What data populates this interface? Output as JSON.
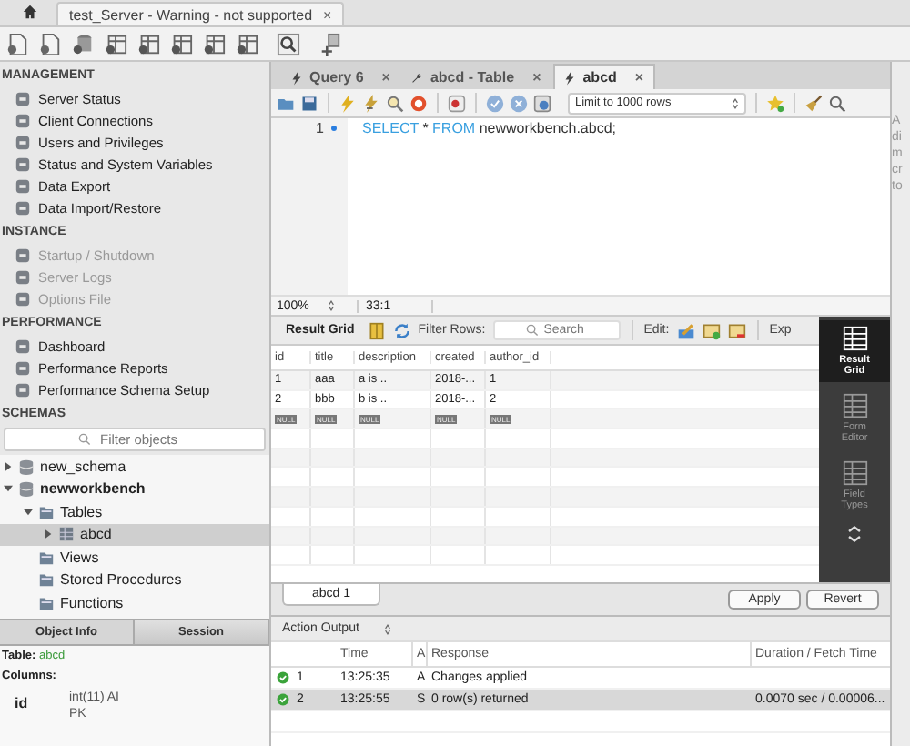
{
  "window_tabs": [
    {
      "label": "test_Server - Warning - not supported",
      "close": "×",
      "selected": true
    }
  ],
  "sidebar": {
    "sections": [
      {
        "title": "MANAGEMENT",
        "items": [
          {
            "label": "Server Status",
            "disabled": false
          },
          {
            "label": "Client Connections",
            "disabled": false
          },
          {
            "label": "Users and Privileges",
            "disabled": false
          },
          {
            "label": "Status and System Variables",
            "disabled": false
          },
          {
            "label": "Data Export",
            "disabled": false
          },
          {
            "label": "Data Import/Restore",
            "disabled": false
          }
        ]
      },
      {
        "title": "INSTANCE",
        "items": [
          {
            "label": "Startup / Shutdown",
            "disabled": true
          },
          {
            "label": "Server Logs",
            "disabled": true
          },
          {
            "label": "Options File",
            "disabled": true
          }
        ]
      },
      {
        "title": "PERFORMANCE",
        "items": [
          {
            "label": "Dashboard",
            "disabled": false
          },
          {
            "label": "Performance Reports",
            "disabled": false
          },
          {
            "label": "Performance Schema Setup",
            "disabled": false
          }
        ]
      }
    ]
  },
  "schemas": {
    "title": "SCHEMAS",
    "filter_placeholder": "Filter objects",
    "tree": [
      {
        "label": "new_schema",
        "kind": "schema",
        "expanded": false,
        "default": false,
        "selected": false
      },
      {
        "label": "newworkbench",
        "kind": "schema",
        "expanded": true,
        "default": true,
        "selected": false,
        "children": [
          {
            "label": "Tables",
            "kind": "folder",
            "expanded": true,
            "default": false,
            "selected": false,
            "children": [
              {
                "label": "abcd",
                "kind": "table",
                "expanded": false,
                "default": false,
                "selected": true
              }
            ]
          },
          {
            "label": "Views",
            "kind": "folder",
            "default": false,
            "selected": false
          },
          {
            "label": "Stored Procedures",
            "kind": "folder",
            "default": false,
            "selected": false
          },
          {
            "label": "Functions",
            "kind": "folder",
            "default": false,
            "selected": false
          }
        ]
      }
    ]
  },
  "info_tabs": [
    {
      "label": "Object Info",
      "selected": true
    },
    {
      "label": "Session",
      "selected": false
    }
  ],
  "object_info": {
    "table_label": "Table:",
    "table_name": "abcd",
    "columns_label": "Columns:",
    "columns": [
      {
        "name": "id",
        "type": "int(11) AI PK"
      }
    ]
  },
  "query_tabs": [
    {
      "label": "Query 6",
      "kind": "query",
      "selected": false,
      "close": "×"
    },
    {
      "label": "abcd - Table",
      "kind": "table",
      "selected": false,
      "close": "×"
    },
    {
      "label": "abcd",
      "kind": "query",
      "selected": true,
      "close": "×"
    }
  ],
  "editor": {
    "limit": "Limit to 1000 rows",
    "lines": [
      {
        "number": "1",
        "tokens": [
          {
            "text": "SELECT",
            "kind": "keyword"
          },
          {
            "text": " * ",
            "kind": "plain"
          },
          {
            "text": "FROM",
            "kind": "keyword"
          },
          {
            "text": " newworkbench.abcd;",
            "kind": "plain"
          }
        ]
      }
    ]
  },
  "help_panel": [
    "A",
    "di",
    "m",
    "cr",
    "to"
  ],
  "status": {
    "zoom": "100%",
    "position": "33:1"
  },
  "result_toolbar": {
    "title": "Result Grid",
    "filter_label": "Filter Rows:",
    "search_placeholder": "Search",
    "edit_label": "Edit:",
    "export_label": "Exp"
  },
  "grid": {
    "columns": [
      "id",
      "title",
      "description",
      "created",
      "author_id"
    ],
    "rows": [
      {
        "kind": "data",
        "cells": [
          "1",
          "aaa",
          "a is ..",
          "2018-...",
          "1"
        ]
      },
      {
        "kind": "data",
        "cells": [
          "2",
          "bbb",
          "b is ..",
          "2018-...",
          "2"
        ]
      },
      {
        "kind": "null",
        "cells": [
          "NULL",
          "NULL",
          "NULL",
          "NULL",
          "NULL"
        ]
      }
    ]
  },
  "side_views": [
    {
      "label": "Result Grid",
      "selected": true
    },
    {
      "label": "Form Editor",
      "selected": false
    },
    {
      "label": "Field Types",
      "selected": false
    }
  ],
  "result_tabs": [
    {
      "label": "abcd 1",
      "selected": true
    }
  ],
  "result_buttons": [
    "Apply",
    "Revert"
  ],
  "output": {
    "title": "Action Output",
    "columns": [
      "Time",
      "A",
      "Response",
      "Duration / Fetch Time"
    ],
    "rows": [
      {
        "succeeded": true,
        "number": "1",
        "time": "13:25:35",
        "action": "A",
        "response": "Changes applied",
        "selected": false
      },
      {
        "succeeded": true,
        "number": "2",
        "time": "13:25:55",
        "action": "S",
        "response": "0 row(s) returned",
        "duration": "0.0070 sec / 0.00006...",
        "selected": true
      }
    ]
  }
}
